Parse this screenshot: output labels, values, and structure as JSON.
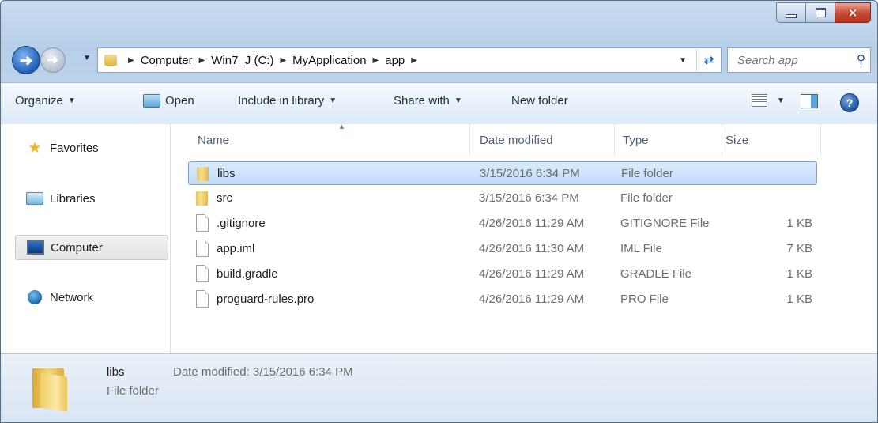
{
  "window": {
    "caption_buttons": {
      "minimize": "minimize",
      "maximize": "maximize",
      "close": "×"
    }
  },
  "address_bar": {
    "breadcrumbs": [
      "Computer",
      "Win7_J (C:)",
      "MyApplication",
      "app"
    ],
    "search_placeholder": "Search app"
  },
  "toolbar": {
    "organize": "Organize",
    "open": "Open",
    "include_in_library": "Include in library",
    "share_with": "Share with",
    "new_folder": "New folder"
  },
  "nav_pane": {
    "items": [
      {
        "label": "Favorites",
        "icon": "star-icon"
      },
      {
        "label": "Libraries",
        "icon": "libraries-icon"
      },
      {
        "label": "Computer",
        "icon": "computer-icon",
        "selected": true
      },
      {
        "label": "Network",
        "icon": "network-icon"
      }
    ]
  },
  "file_list": {
    "columns": [
      "Name",
      "Date modified",
      "Type",
      "Size"
    ],
    "rows": [
      {
        "name": "libs",
        "date": "3/15/2016 6:34 PM",
        "type": "File folder",
        "size": "",
        "icon": "folder-icon",
        "selected": true
      },
      {
        "name": "src",
        "date": "3/15/2016 6:34 PM",
        "type": "File folder",
        "size": "",
        "icon": "folder-icon"
      },
      {
        "name": ".gitignore",
        "date": "4/26/2016 11:29 AM",
        "type": "GITIGNORE File",
        "size": "1 KB",
        "icon": "file-icon"
      },
      {
        "name": "app.iml",
        "date": "4/26/2016 11:30 AM",
        "type": "IML File",
        "size": "7 KB",
        "icon": "file-icon"
      },
      {
        "name": "build.gradle",
        "date": "4/26/2016 11:29 AM",
        "type": "GRADLE File",
        "size": "1 KB",
        "icon": "file-icon"
      },
      {
        "name": "proguard-rules.pro",
        "date": "4/26/2016 11:29 AM",
        "type": "PRO File",
        "size": "1 KB",
        "icon": "file-icon"
      }
    ]
  },
  "details_pane": {
    "name": "libs",
    "type": "File folder",
    "date_label": "Date modified: 3/15/2016 6:34 PM"
  },
  "colors": {
    "selection": "#cce4fc",
    "selection_border": "#7da2ce",
    "close_button": "#c44a33"
  }
}
